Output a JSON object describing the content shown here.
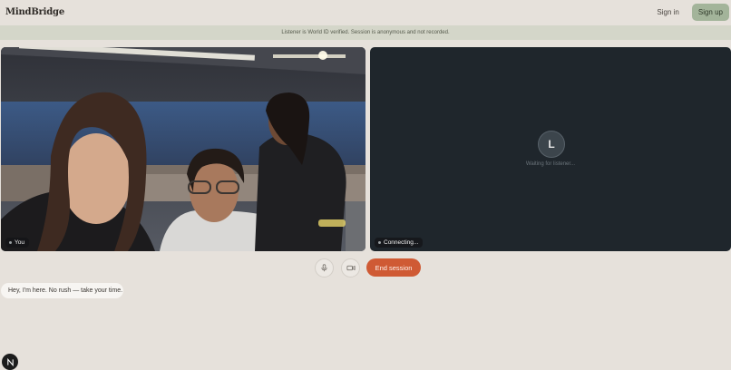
{
  "header": {
    "logo": "MindBridge",
    "sign_in_label": "Sign in",
    "sign_up_label": "Sign up"
  },
  "banner": {
    "text": "Listener is World ID verified. Session is anonymous and not recorded."
  },
  "self_video": {
    "label": "You"
  },
  "remote_video": {
    "avatar_initial": "L",
    "status_text": "Waiting for listener...",
    "label": "Connecting..."
  },
  "controls": {
    "mic_icon": "microphone-icon",
    "camera_icon": "video-camera-icon",
    "end_label": "End session"
  },
  "chat": {
    "message": "Hey, I'm here. No rush — take your time."
  },
  "badge": {
    "icon": "n-logo-icon"
  },
  "colors": {
    "background": "#e6e1db",
    "banner": "#d4d6c9",
    "signup": "#a3b49a",
    "end_session": "#cf5a34",
    "remote_panel": "#1f262c"
  }
}
